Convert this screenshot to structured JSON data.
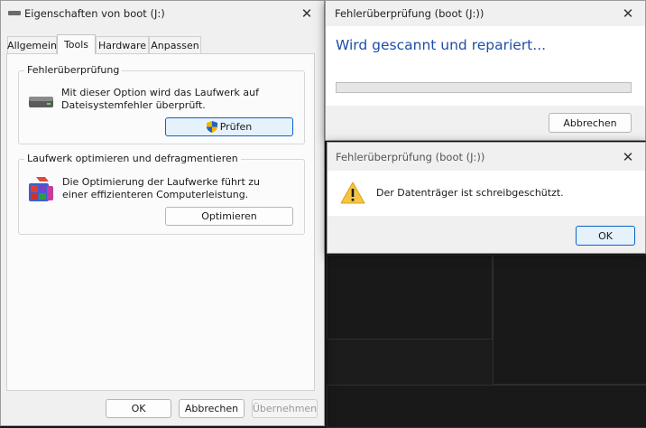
{
  "props": {
    "title": "Eigenschaften von boot (J:)",
    "close_glyph": "✕",
    "tabs": [
      {
        "label": "Allgemein"
      },
      {
        "label": "Tools"
      },
      {
        "label": "Hardware"
      },
      {
        "label": "Anpassen"
      }
    ],
    "active_tab": "Tools",
    "error_check": {
      "title": "Fehlerüberprüfung",
      "description": "Mit dieser Option wird das Laufwerk auf Dateisystemfehler überprüft.",
      "button": "Prüfen",
      "icon": "drive-icon"
    },
    "optimize": {
      "title": "Laufwerk optimieren und defragmentieren",
      "description": "Die Optimierung der Laufwerke führt zu einer effizienteren Computerleistung.",
      "button": "Optimieren",
      "icon": "defrag-icon"
    },
    "footer": {
      "ok": "OK",
      "cancel": "Abbrechen",
      "apply": "Übernehmen"
    }
  },
  "scan": {
    "title": "Fehlerüberprüfung (boot (J:))",
    "status": "Wird gescannt und repariert...",
    "progress": 0,
    "cancel": "Abbrechen"
  },
  "alert": {
    "title": "Fehlerüberprüfung (boot (J:))",
    "message": "Der Datenträger ist schreibgeschützt.",
    "ok": "OK",
    "icon": "warning-icon"
  },
  "colors": {
    "accent": "#0a64c8",
    "heading_blue": "#1f4ea8",
    "warning": "#f6c343"
  }
}
